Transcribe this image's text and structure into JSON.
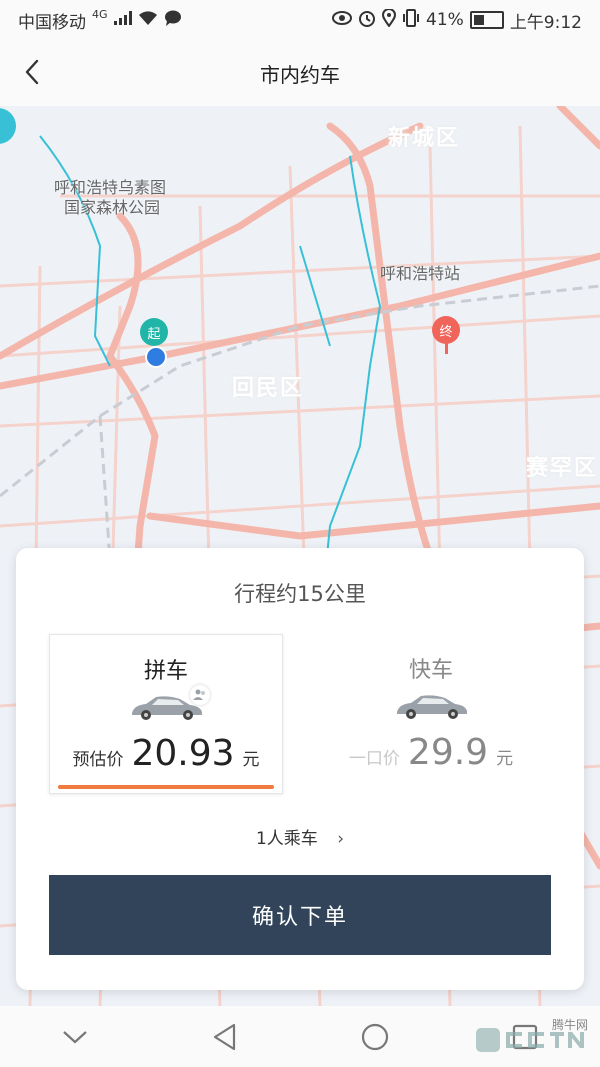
{
  "status_bar": {
    "carrier": "中国移动",
    "network": "4G",
    "battery_percent": "41%",
    "time": "上午9:12"
  },
  "nav": {
    "title": "市内约车",
    "back_icon": "chevron-left-icon"
  },
  "map": {
    "labels": {
      "park_line1": "呼和浩特乌素图",
      "park_line2": "国家森林公园",
      "station": "呼和浩特站",
      "district_xincheng": "新城区",
      "district_huimin": "回民区",
      "district_saihan": "赛罕区"
    },
    "start_pin": "起",
    "end_pin": "终"
  },
  "card": {
    "trip_distance": "行程约15公里",
    "options": [
      {
        "title": "拼车",
        "price_label": "预估价",
        "price": "20.93",
        "unit": "元",
        "selected": true
      },
      {
        "title": "快车",
        "price_label": "一口价",
        "price": "29.9",
        "unit": "元",
        "selected": false
      }
    ],
    "passengers": "1人乘车",
    "passengers_chevron": "›",
    "confirm_label": "确认下单"
  },
  "colors": {
    "accent_underline": "#f07b3f",
    "confirm_button": "#31445a",
    "start_pin": "#21b5a7",
    "end_pin": "#f0645a",
    "road": "#f4b6aa",
    "river": "#37c0d6"
  },
  "watermark": {
    "small": "腾牛网"
  }
}
